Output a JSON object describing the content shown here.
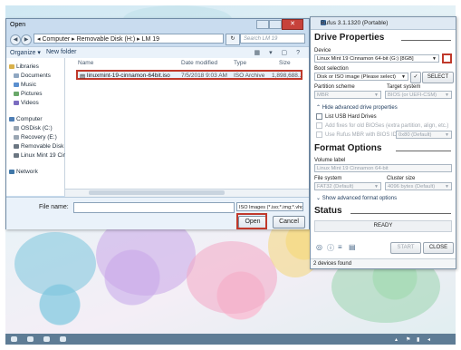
{
  "open_dialog": {
    "title": "Open",
    "breadcrumb": "◂ Computer ▸ Removable Disk (H:) ▸ LM 19",
    "search_placeholder": "Search LM 19",
    "toolbar": {
      "organize": "Organize ▾",
      "new_folder": "New folder"
    },
    "nav": {
      "libraries": "Libraries",
      "documents": "Documents",
      "music": "Music",
      "pictures": "Pictures",
      "videos": "Videos",
      "computer": "Computer",
      "osdisk": "OSDisk (C:)",
      "recovery": "Recovery (E:)",
      "removable": "Removable Disk (I",
      "linux_mint": "Linux Mint 19 Cinn",
      "network": "Network"
    },
    "columns": {
      "name": "Name",
      "date": "Date modified",
      "type": "Type",
      "size": "Size"
    },
    "file": {
      "name": "linuxmint-19-cinnamon-64bit.iso",
      "date": "7/5/2018 9:03 AM",
      "type": "ISO Archive",
      "size": "1,898,688..."
    },
    "file_name_label": "File name:",
    "file_name_value": "",
    "filter": "ISO Images (*.iso;*.img;*.vhd;...",
    "open_label": "Open",
    "cancel_label": "Cancel"
  },
  "rufus": {
    "title": "Rufus 3.1.1320 (Portable)",
    "drive_properties": "Drive Properties",
    "device_label": "Device",
    "device_value": "Linux Mint 19 Cinnamon 64-bit (G:) [8GB]",
    "boot_label": "Boot selection",
    "boot_value": "Disk or ISO image (Please select)",
    "select_label": "SELECT",
    "partition_label": "Partition scheme",
    "partition_value": "MBR",
    "target_label": "Target system",
    "target_value": "BIOS (or UEFI-CSM)",
    "hide_adv": "Hide advanced drive properties",
    "list_usb": "List USB Hard Drives",
    "add_fixes": "Add fixes for old BIOSes (extra partition, align, etc.)",
    "use_bios_id": "Use Rufus MBR with BIOS ID",
    "bios_id_value": "0x80 (Default)",
    "format_options": "Format Options",
    "volume_label": "Volume label",
    "volume_value": "Linux Mint 19 Cinnamon 64-bit",
    "fs_label": "File system",
    "fs_value": "FAT32 (Default)",
    "cluster_label": "Cluster size",
    "cluster_value": "4096 bytes (Default)",
    "show_adv_format": "Show advanced format options",
    "status": "Status",
    "status_value": "READY",
    "start_label": "START",
    "close_label": "CLOSE",
    "devices_found": "2 devices found"
  },
  "colors": {
    "highlight": "#c0392b",
    "close_red": "#c7423b"
  }
}
